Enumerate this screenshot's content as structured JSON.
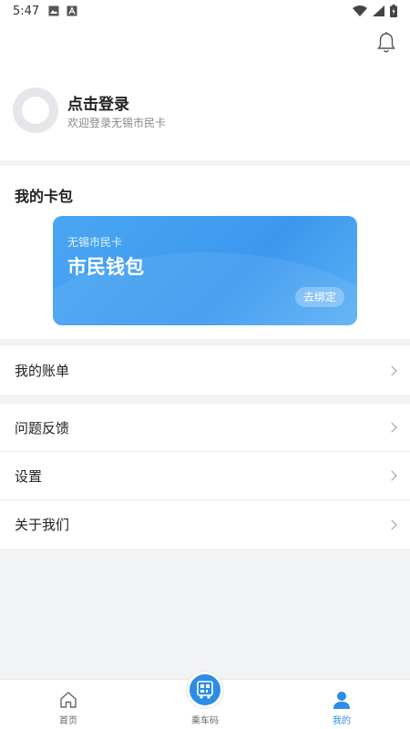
{
  "status_bar": {
    "time": "5:47"
  },
  "profile": {
    "title": "点击登录",
    "subtitle": "欢迎登录无锡市民卡"
  },
  "wallet": {
    "section_title": "我的卡包",
    "card_subtitle": "无锡市民卡",
    "card_title": "市民钱包",
    "bind_label": "去绑定"
  },
  "menu": {
    "group1": [
      {
        "label": "我的账单"
      }
    ],
    "group2": [
      {
        "label": "问题反馈"
      },
      {
        "label": "设置"
      },
      {
        "label": "关于我们"
      }
    ]
  },
  "tabbar": {
    "home": "首页",
    "ride_code": "乘车码",
    "mine": "我的"
  },
  "colors": {
    "accent": "#2c8de8",
    "card": "#4aa6f3"
  }
}
